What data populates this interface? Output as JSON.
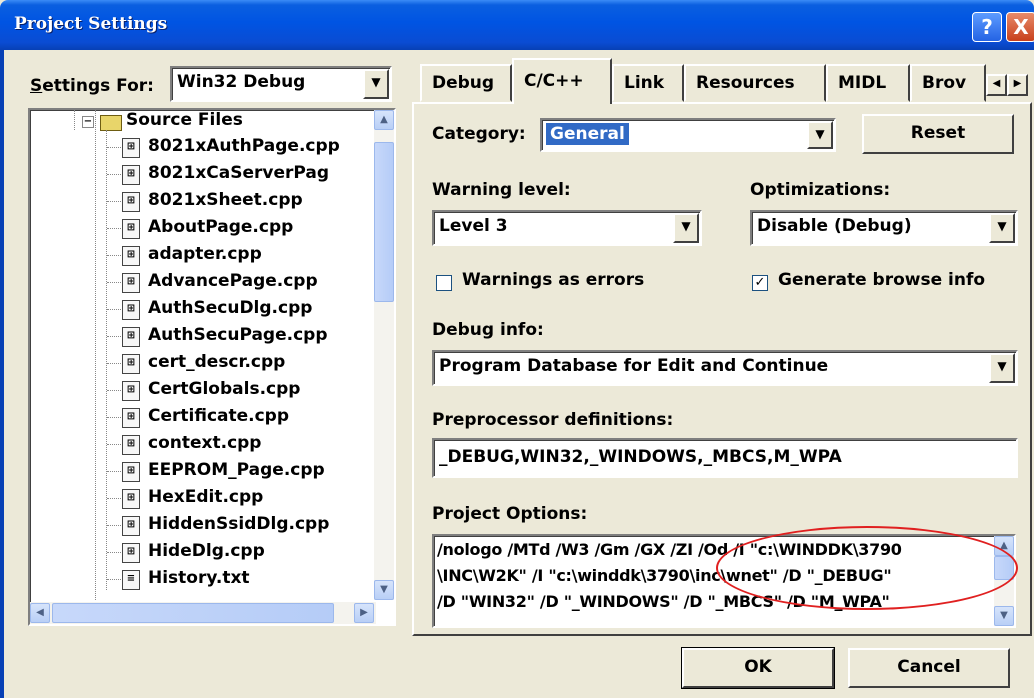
{
  "window": {
    "title": "Project Settings",
    "help": "?",
    "close": "X"
  },
  "settings_for": {
    "label": "Settings For:",
    "value": "Win32 Debug"
  },
  "tree": {
    "root": "Source Files",
    "items": [
      "8021xAuthPage.cpp",
      "8021xCaServerPag",
      "8021xSheet.cpp",
      "AboutPage.cpp",
      "adapter.cpp",
      "AdvancePage.cpp",
      "AuthSecuDlg.cpp",
      "AuthSecuPage.cpp",
      "cert_descr.cpp",
      "CertGlobals.cpp",
      "Certificate.cpp",
      "context.cpp",
      "EEPROM_Page.cpp",
      "HexEdit.cpp",
      "HiddenSsidDlg.cpp",
      "HideDlg.cpp",
      "History.txt"
    ]
  },
  "tabs": [
    "Debug",
    "C/C++",
    "Link",
    "Resources",
    "MIDL",
    "Brov"
  ],
  "active_tab": "C/C++",
  "category": {
    "label": "Category:",
    "value": "General"
  },
  "reset": "Reset",
  "warning_level": {
    "label": "Warning level:",
    "value": "Level 3"
  },
  "optimizations": {
    "label": "Optimizations:",
    "value": "Disable (Debug)"
  },
  "warnings_as_errors": {
    "label": "Warnings as errors",
    "checked": false
  },
  "browse_info": {
    "label": "Generate browse info",
    "checked": true,
    "mark": "✓"
  },
  "debug_info": {
    "label": "Debug info:",
    "value": "Program Database for Edit and Continue"
  },
  "preprocessor": {
    "label": "Preprocessor definitions:",
    "value": "_DEBUG,WIN32,_WINDOWS,_MBCS,M_WPA"
  },
  "project_options": {
    "label": "Project Options:",
    "lines": [
      "/nologo /MTd /W3 /Gm /GX /ZI /Od /I \"c:\\WINDDK\\3790",
      "\\INC\\W2K\" /I \"c:\\winddk\\3790\\inc\\wnet\" /D \"_DEBUG\"",
      "/D \"WIN32\" /D \"_WINDOWS\" /D \"_MBCS\" /D \"M_WPA\""
    ]
  },
  "buttons": {
    "ok": "OK",
    "cancel": "Cancel"
  },
  "colors": {
    "titlebar": "#0054e3",
    "face": "#ece9d8",
    "highlight": "#316ac5",
    "annotation": "#e02020"
  }
}
